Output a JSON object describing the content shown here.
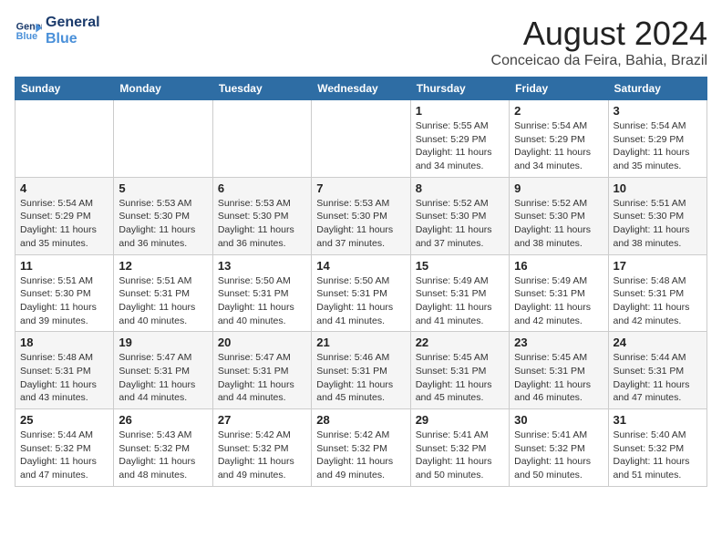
{
  "logo": {
    "line1": "General",
    "line2": "Blue"
  },
  "title": "August 2024",
  "location": "Conceicao da Feira, Bahia, Brazil",
  "weekdays": [
    "Sunday",
    "Monday",
    "Tuesday",
    "Wednesday",
    "Thursday",
    "Friday",
    "Saturday"
  ],
  "weeks": [
    [
      {
        "day": "",
        "info": ""
      },
      {
        "day": "",
        "info": ""
      },
      {
        "day": "",
        "info": ""
      },
      {
        "day": "",
        "info": ""
      },
      {
        "day": "1",
        "info": "Sunrise: 5:55 AM\nSunset: 5:29 PM\nDaylight: 11 hours\nand 34 minutes."
      },
      {
        "day": "2",
        "info": "Sunrise: 5:54 AM\nSunset: 5:29 PM\nDaylight: 11 hours\nand 34 minutes."
      },
      {
        "day": "3",
        "info": "Sunrise: 5:54 AM\nSunset: 5:29 PM\nDaylight: 11 hours\nand 35 minutes."
      }
    ],
    [
      {
        "day": "4",
        "info": "Sunrise: 5:54 AM\nSunset: 5:29 PM\nDaylight: 11 hours\nand 35 minutes."
      },
      {
        "day": "5",
        "info": "Sunrise: 5:53 AM\nSunset: 5:30 PM\nDaylight: 11 hours\nand 36 minutes."
      },
      {
        "day": "6",
        "info": "Sunrise: 5:53 AM\nSunset: 5:30 PM\nDaylight: 11 hours\nand 36 minutes."
      },
      {
        "day": "7",
        "info": "Sunrise: 5:53 AM\nSunset: 5:30 PM\nDaylight: 11 hours\nand 37 minutes."
      },
      {
        "day": "8",
        "info": "Sunrise: 5:52 AM\nSunset: 5:30 PM\nDaylight: 11 hours\nand 37 minutes."
      },
      {
        "day": "9",
        "info": "Sunrise: 5:52 AM\nSunset: 5:30 PM\nDaylight: 11 hours\nand 38 minutes."
      },
      {
        "day": "10",
        "info": "Sunrise: 5:51 AM\nSunset: 5:30 PM\nDaylight: 11 hours\nand 38 minutes."
      }
    ],
    [
      {
        "day": "11",
        "info": "Sunrise: 5:51 AM\nSunset: 5:30 PM\nDaylight: 11 hours\nand 39 minutes."
      },
      {
        "day": "12",
        "info": "Sunrise: 5:51 AM\nSunset: 5:31 PM\nDaylight: 11 hours\nand 40 minutes."
      },
      {
        "day": "13",
        "info": "Sunrise: 5:50 AM\nSunset: 5:31 PM\nDaylight: 11 hours\nand 40 minutes."
      },
      {
        "day": "14",
        "info": "Sunrise: 5:50 AM\nSunset: 5:31 PM\nDaylight: 11 hours\nand 41 minutes."
      },
      {
        "day": "15",
        "info": "Sunrise: 5:49 AM\nSunset: 5:31 PM\nDaylight: 11 hours\nand 41 minutes."
      },
      {
        "day": "16",
        "info": "Sunrise: 5:49 AM\nSunset: 5:31 PM\nDaylight: 11 hours\nand 42 minutes."
      },
      {
        "day": "17",
        "info": "Sunrise: 5:48 AM\nSunset: 5:31 PM\nDaylight: 11 hours\nand 42 minutes."
      }
    ],
    [
      {
        "day": "18",
        "info": "Sunrise: 5:48 AM\nSunset: 5:31 PM\nDaylight: 11 hours\nand 43 minutes."
      },
      {
        "day": "19",
        "info": "Sunrise: 5:47 AM\nSunset: 5:31 PM\nDaylight: 11 hours\nand 44 minutes."
      },
      {
        "day": "20",
        "info": "Sunrise: 5:47 AM\nSunset: 5:31 PM\nDaylight: 11 hours\nand 44 minutes."
      },
      {
        "day": "21",
        "info": "Sunrise: 5:46 AM\nSunset: 5:31 PM\nDaylight: 11 hours\nand 45 minutes."
      },
      {
        "day": "22",
        "info": "Sunrise: 5:45 AM\nSunset: 5:31 PM\nDaylight: 11 hours\nand 45 minutes."
      },
      {
        "day": "23",
        "info": "Sunrise: 5:45 AM\nSunset: 5:31 PM\nDaylight: 11 hours\nand 46 minutes."
      },
      {
        "day": "24",
        "info": "Sunrise: 5:44 AM\nSunset: 5:31 PM\nDaylight: 11 hours\nand 47 minutes."
      }
    ],
    [
      {
        "day": "25",
        "info": "Sunrise: 5:44 AM\nSunset: 5:32 PM\nDaylight: 11 hours\nand 47 minutes."
      },
      {
        "day": "26",
        "info": "Sunrise: 5:43 AM\nSunset: 5:32 PM\nDaylight: 11 hours\nand 48 minutes."
      },
      {
        "day": "27",
        "info": "Sunrise: 5:42 AM\nSunset: 5:32 PM\nDaylight: 11 hours\nand 49 minutes."
      },
      {
        "day": "28",
        "info": "Sunrise: 5:42 AM\nSunset: 5:32 PM\nDaylight: 11 hours\nand 49 minutes."
      },
      {
        "day": "29",
        "info": "Sunrise: 5:41 AM\nSunset: 5:32 PM\nDaylight: 11 hours\nand 50 minutes."
      },
      {
        "day": "30",
        "info": "Sunrise: 5:41 AM\nSunset: 5:32 PM\nDaylight: 11 hours\nand 50 minutes."
      },
      {
        "day": "31",
        "info": "Sunrise: 5:40 AM\nSunset: 5:32 PM\nDaylight: 11 hours\nand 51 minutes."
      }
    ]
  ]
}
